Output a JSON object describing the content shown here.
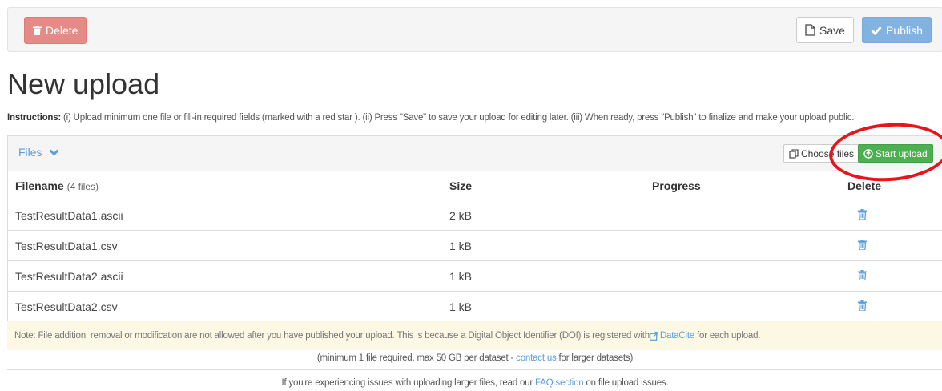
{
  "toolbar": {
    "delete_label": "Delete",
    "save_label": "Save",
    "publish_label": "Publish"
  },
  "page": {
    "title": "New upload",
    "instructions_bold": "Instructions:",
    "instructions_text": " (i) Upload minimum one file or fill-in required fields (marked with a red star ). (ii) Press \"Save\" to save your upload for editing later. (iii) When ready, press \"Publish\" to finalize and make your upload public."
  },
  "files_panel": {
    "toggle_label": "Files",
    "choose_files_label": "Choose files",
    "start_upload_label": "Start upload",
    "columns": {
      "filename": "Filename",
      "count": "(4 files)",
      "size": "Size",
      "progress": "Progress",
      "delete": "Delete"
    },
    "files": [
      {
        "name": "TestResultData1.ascii",
        "size": "2 kB"
      },
      {
        "name": "TestResultData1.csv",
        "size": "1 kB"
      },
      {
        "name": "TestResultData2.ascii",
        "size": "1 kB"
      },
      {
        "name": "TestResultData2.csv",
        "size": "1 kB"
      }
    ]
  },
  "note": {
    "text": "Note: File addition, removal or modification are not allowed after you have published your upload. This is because a Digital Object Identifier (DOI) is registered with ",
    "link": "DataCite",
    "text_after": " for each upload."
  },
  "limits": {
    "before": "(minimum 1 file required, max 50 GB per dataset - ",
    "link": "contact us",
    "after": " for larger datasets)"
  },
  "faq": {
    "before": "If you're experiencing issues with uploading larger files, read our ",
    "link": "FAQ section",
    "after": " on file upload issues."
  },
  "colors": {
    "delete_button": "#e48a87",
    "publish_button": "#82b3e0",
    "start_upload_button": "#4caf50",
    "link": "#5a9fd9",
    "annotation_circle": "#e8141b"
  }
}
